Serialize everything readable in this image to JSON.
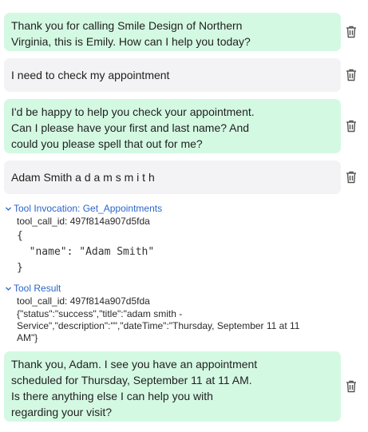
{
  "messages": [
    {
      "role": "assistant",
      "text": "Thank you for calling Smile Design of Northern\nVirginia, this is Emily. How can I help you today?"
    },
    {
      "role": "user",
      "text": "I need to check my appointment"
    },
    {
      "role": "assistant",
      "text": "I'd be happy to help you check your appointment.\nCan I please have your first and last name? And\ncould you please spell that out for me?"
    },
    {
      "role": "user",
      "text": "Adam Smith a d a m s m i t h"
    },
    {
      "role": "assistant",
      "text": "Thank you, Adam. I see you have an appointment\nscheduled for Thursday, September 11 at 11 AM.\nIs there anything else I can help you with\nregarding your visit?"
    }
  ],
  "tool_invocation": {
    "label": "Tool Invocation: Get_Appointments",
    "call_id": "tool_call_id: 497f814a907d5fda",
    "code": "{\n  \"name\": \"Adam Smith\"\n}"
  },
  "tool_result": {
    "label": "Tool Result",
    "call_id": "tool_call_id: 497f814a907d5fda",
    "content": "{\"status\":\"success\",\"title\":\"adam smith - Service\",\"description\":\"\",\"dateTime\":\"Thursday, September 11 at 11 AM\"}"
  },
  "icons": {
    "delete": "trash-icon",
    "expand": "chevron-down-icon"
  },
  "colors": {
    "assistant_bubble": "#d4f9e3",
    "user_bubble": "#f3f3f5",
    "link": "#2b66c9"
  }
}
